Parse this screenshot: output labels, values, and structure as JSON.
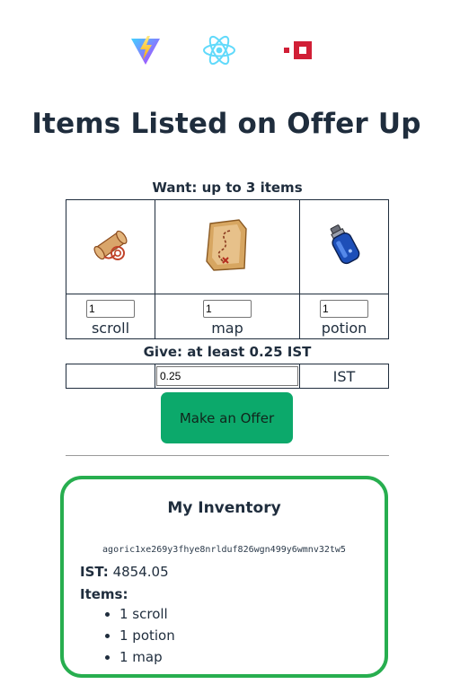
{
  "logos": [
    "vite-logo",
    "react-logo",
    "agoric-logo"
  ],
  "page_title": "Items Listed on Offer Up",
  "want": {
    "caption": "Want: up to 3 items",
    "items": [
      {
        "icon": "scroll-icon",
        "quantity": "1",
        "label": "scroll"
      },
      {
        "icon": "map-icon",
        "quantity": "1",
        "label": "map"
      },
      {
        "icon": "potion-icon",
        "quantity": "1",
        "label": "potion"
      }
    ]
  },
  "give": {
    "caption": "Give: at least 0.25 IST",
    "amount": "0.25",
    "currency": "IST"
  },
  "offer_button": "Make an Offer",
  "inventory": {
    "title": "My Inventory",
    "address": "agoric1xe269y3fhye8nrlduf826wgn499y6wmnv32tw5",
    "ist_label": "IST:",
    "ist_value": "4854.05",
    "items_label": "Items:",
    "items": [
      "1 scroll",
      "1 potion",
      "1 map"
    ]
  },
  "colors": {
    "accent_button": "#0ca96b",
    "inventory_border": "#27ae4f",
    "text": "#1f2d3d"
  }
}
